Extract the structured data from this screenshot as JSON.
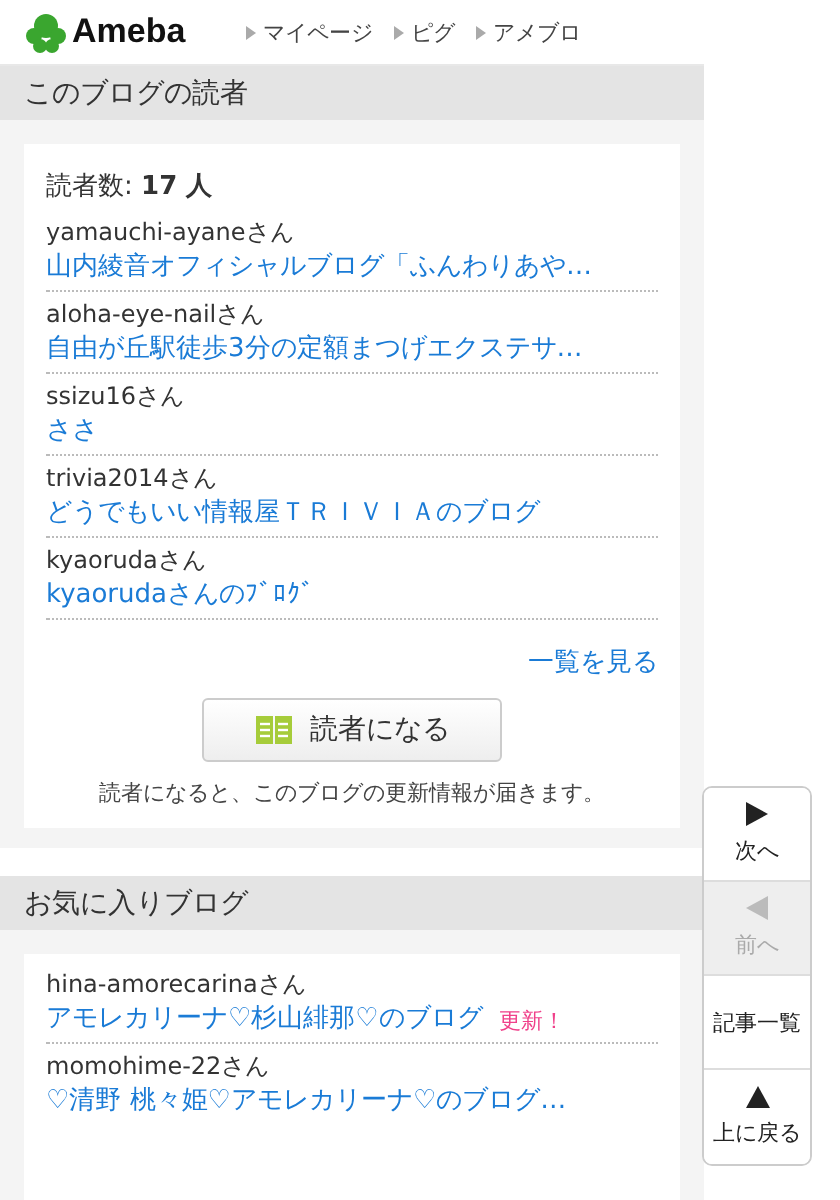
{
  "header": {
    "logo": "Ameba",
    "nav": [
      "マイページ",
      "ピグ",
      "アメブロ"
    ]
  },
  "readers": {
    "title": "このブログの読者",
    "count_label": "読者数:",
    "count": "17 人",
    "items": [
      {
        "user": "yamauchi-ayaneさん",
        "blog": "山内綾音オフィシャルブログ「ふんわりあや…"
      },
      {
        "user": "aloha-eye-nailさん",
        "blog": "自由が丘駅徒歩3分の定額まつげエクステサ…"
      },
      {
        "user": "ssizu16さん",
        "blog": "ささ"
      },
      {
        "user": "trivia2014さん",
        "blog": "どうでもいい情報屋ＴＲＩＶＩＡのブログ"
      },
      {
        "user": "kyaorudaさん",
        "blog": "kyaorudaさんのﾌﾞﾛｸﾞ"
      }
    ],
    "more_link": "一覧を見る",
    "button": "読者になる",
    "note": "読者になると、このブログの更新情報が届きます。"
  },
  "favorites": {
    "title": "お気に入りブログ",
    "items": [
      {
        "user": "hina-amorecarinaさん",
        "blog": "アモレカリーナ♡杉山緋那♡のブログ",
        "badge": "更新！"
      },
      {
        "user": "momohime-22さん",
        "blog": "♡清野 桃々姫♡アモレカリーナ♡のブログ…"
      }
    ]
  },
  "side_nav": [
    {
      "kind": "next",
      "label": "次へ",
      "disabled": false
    },
    {
      "kind": "prev",
      "label": "前へ",
      "disabled": true
    },
    {
      "kind": "list",
      "label": "記事一覧",
      "disabled": false
    },
    {
      "kind": "top",
      "label": "上に戻る",
      "disabled": false
    }
  ]
}
